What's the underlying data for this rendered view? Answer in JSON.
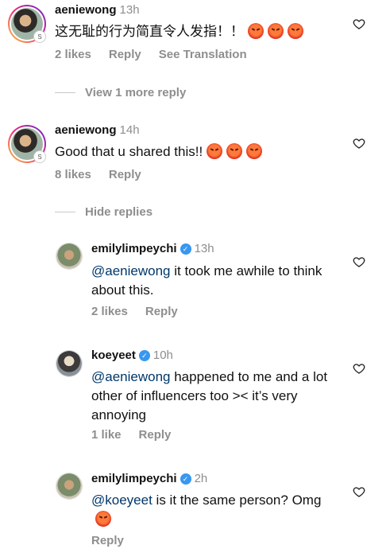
{
  "comments": [
    {
      "username": "aeniewong",
      "time": "13h",
      "text": "这无耻的行为简直令人发指！！",
      "likes": "2 likes",
      "reply": "Reply",
      "translate": "See Translation",
      "emoji_count": 3
    },
    {
      "username": "aeniewong",
      "time": "14h",
      "text": "Good that u shared this!!",
      "likes": "8 likes",
      "reply": "Reply",
      "emoji_count": 3
    }
  ],
  "view_more": "View 1 more reply",
  "hide_replies": "Hide replies",
  "replies": [
    {
      "username": "emilylimpeychi",
      "time": "13h",
      "mention": "@aeniewong",
      "text": " it took me awhile to think about this.",
      "likes": "2 likes",
      "reply": "Reply"
    },
    {
      "username": "koeyeet",
      "time": "10h",
      "mention": "@aeniewong",
      "text": " happened to me and a lot other of influencers too >< it’s very annoying",
      "likes": "1 like",
      "reply": "Reply"
    },
    {
      "username": "emilylimpeychi",
      "time": "2h",
      "mention": "@koeyeet",
      "text": " is it the same person? Omg",
      "reply": "Reply"
    }
  ],
  "icons": {
    "heart": "heart-outline-icon",
    "verified": "verified-badge-icon",
    "emoji": "angry-face-emoji"
  }
}
